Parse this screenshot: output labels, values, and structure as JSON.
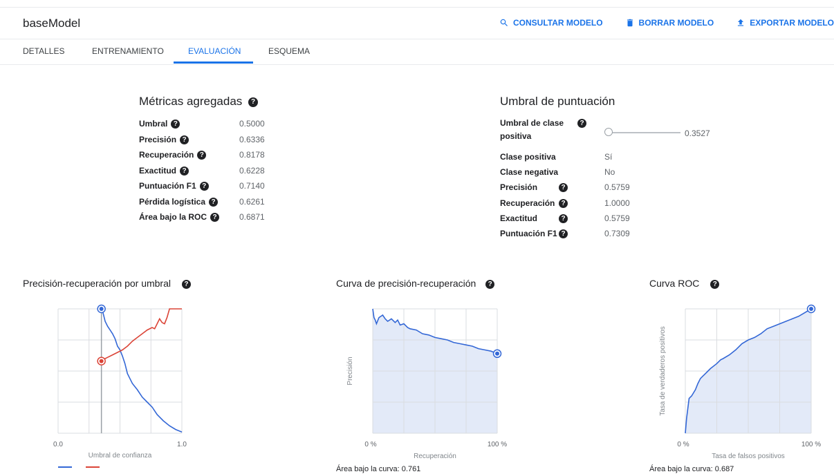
{
  "header": {
    "title": "baseModel",
    "actions": [
      {
        "label": "CONSULTAR MODELO",
        "icon": "search-icon"
      },
      {
        "label": "BORRAR MODELO",
        "icon": "trash-icon"
      },
      {
        "label": "EXPORTAR MODELO",
        "icon": "export-icon"
      }
    ]
  },
  "tabs": [
    "DETALLES",
    "ENTRENAMIENTO",
    "EVALUACIÓN",
    "ESQUEMA"
  ],
  "active_tab": "EVALUACIÓN",
  "aggregate": {
    "title": "Métricas agregadas",
    "rows": [
      {
        "label": "Umbral",
        "value": "0.5000"
      },
      {
        "label": "Precisión",
        "value": "0.6336"
      },
      {
        "label": "Recuperación",
        "value": "0.8178"
      },
      {
        "label": "Exactitud",
        "value": "0.6228"
      },
      {
        "label": "Puntuación F1",
        "value": "0.7140"
      },
      {
        "label": "Pérdida logística",
        "value": "0.6261"
      },
      {
        "label": "Área bajo la ROC",
        "value": "0.6871"
      }
    ]
  },
  "threshold": {
    "title": "Umbral de puntuación",
    "slider_label_1": "Umbral de clase",
    "slider_label_2": "positiva",
    "slider_value": "0.3527",
    "slider_fraction": 0.0,
    "rows": [
      {
        "label": "Clase positiva",
        "value": "Sí",
        "help": false
      },
      {
        "label": "Clase negativa",
        "value": "No",
        "help": false
      },
      {
        "label": "Precisión",
        "value": "0.5759",
        "help": true
      },
      {
        "label": "Recuperación",
        "value": "1.0000",
        "help": true
      },
      {
        "label": "Exactitud",
        "value": "0.5759",
        "help": true
      },
      {
        "label": "Puntuación F1",
        "value": "0.7309",
        "help": true
      }
    ]
  },
  "colors": {
    "accent": "#1a73e8",
    "precision": "#3367d6",
    "recall": "#db4437",
    "fill": "#e3eaf8"
  },
  "chart_data": [
    {
      "type": "line",
      "title": "Precisión-recuperación por umbral",
      "xlabel": "Umbral de confianza",
      "ylabel": "",
      "xlim": [
        0,
        1
      ],
      "ylim": [
        0,
        1
      ],
      "x_ticks": [
        "0.0",
        "1.0"
      ],
      "grid": true,
      "marker_x": 0.35,
      "series": [
        {
          "values_key": "blue",
          "x": [
            0.35,
            0.36,
            0.38,
            0.4,
            0.42,
            0.44,
            0.46,
            0.48,
            0.5,
            0.52,
            0.54,
            0.56,
            0.58,
            0.6,
            0.64,
            0.68,
            0.72,
            0.76,
            0.8,
            0.85,
            0.9,
            0.95,
            1.0
          ],
          "y": [
            1.0,
            0.98,
            0.9,
            0.86,
            0.83,
            0.8,
            0.76,
            0.7,
            0.67,
            0.62,
            0.56,
            0.48,
            0.44,
            0.4,
            0.35,
            0.29,
            0.25,
            0.21,
            0.15,
            0.1,
            0.06,
            0.03,
            0.01
          ]
        },
        {
          "values_key": "red",
          "x": [
            0.35,
            0.38,
            0.4,
            0.44,
            0.48,
            0.52,
            0.56,
            0.6,
            0.64,
            0.68,
            0.72,
            0.76,
            0.78,
            0.8,
            0.82,
            0.84,
            0.86,
            0.88,
            0.9,
            0.92,
            1.0
          ],
          "y": [
            0.58,
            0.6,
            0.61,
            0.63,
            0.65,
            0.67,
            0.7,
            0.74,
            0.77,
            0.8,
            0.83,
            0.85,
            0.84,
            0.88,
            0.92,
            0.89,
            0.88,
            0.93,
            1.0,
            1.0,
            1.0
          ]
        }
      ]
    },
    {
      "type": "area",
      "title": "Curva de precisión-recuperación",
      "xlabel": "Recuperación",
      "ylabel": "Precisión",
      "xlim": [
        0,
        100
      ],
      "ylim": [
        0,
        1
      ],
      "x_ticks": [
        "0 %",
        "100 %"
      ],
      "grid": true,
      "x": [
        0,
        1,
        2,
        3,
        5,
        8,
        10,
        12,
        15,
        18,
        20,
        22,
        25,
        28,
        30,
        35,
        40,
        45,
        50,
        55,
        60,
        65,
        70,
        75,
        80,
        85,
        90,
        95,
        100
      ],
      "y": [
        1.0,
        0.93,
        0.91,
        0.88,
        0.93,
        0.95,
        0.92,
        0.9,
        0.92,
        0.89,
        0.91,
        0.87,
        0.88,
        0.85,
        0.84,
        0.83,
        0.8,
        0.79,
        0.77,
        0.76,
        0.75,
        0.73,
        0.72,
        0.71,
        0.7,
        0.68,
        0.67,
        0.66,
        0.64
      ],
      "auc_label": "Área bajo la curva: 0.761"
    },
    {
      "type": "area",
      "title": "Curva ROC",
      "xlabel": "Tasa de falsos positivos",
      "ylabel": "Tasa de verdaderos positivos",
      "xlim": [
        0,
        100
      ],
      "ylim": [
        0,
        1
      ],
      "x_ticks": [
        "0 %",
        "100 %"
      ],
      "grid": true,
      "x": [
        0,
        1,
        2,
        3,
        5,
        8,
        10,
        12,
        15,
        18,
        20,
        25,
        28,
        30,
        35,
        40,
        45,
        50,
        55,
        60,
        65,
        70,
        75,
        80,
        85,
        90,
        95,
        100
      ],
      "y": [
        0.0,
        0.12,
        0.2,
        0.28,
        0.3,
        0.35,
        0.4,
        0.44,
        0.47,
        0.5,
        0.52,
        0.56,
        0.59,
        0.6,
        0.63,
        0.67,
        0.72,
        0.75,
        0.77,
        0.8,
        0.84,
        0.86,
        0.88,
        0.9,
        0.92,
        0.94,
        0.97,
        1.0
      ],
      "auc_label": "Área bajo la curva: 0.687"
    }
  ]
}
